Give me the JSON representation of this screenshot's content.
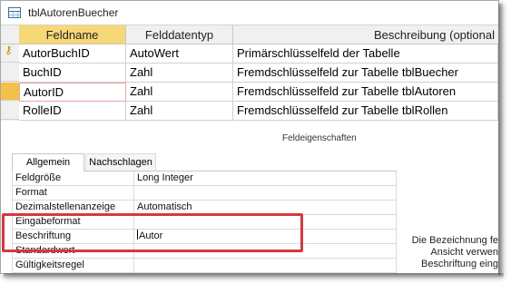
{
  "window": {
    "title": "tblAutorenBuecher",
    "icon": "table-icon"
  },
  "grid": {
    "columns": [
      "Feldname",
      "Felddatentyp",
      "Beschreibung (optional"
    ],
    "rows": [
      {
        "name": "AutorBuchID",
        "type": "AutoWert",
        "description": "Primärschlüsselfeld der Tabelle",
        "key": true
      },
      {
        "name": "BuchID",
        "type": "Zahl",
        "description": "Fremdschlüsselfeld zur Tabelle tblBuecher",
        "key": false
      },
      {
        "name": "AutorID",
        "type": "Zahl",
        "description": "Fremdschlüsselfeld zur Tabelle tblAutoren",
        "key": false,
        "current": true
      },
      {
        "name": "RolleID",
        "type": "Zahl",
        "description": "Fremdschlüsselfeld zur Tabelle tblRollen",
        "key": false
      }
    ]
  },
  "field_properties_label": "Feldeigenschaften",
  "tabs": {
    "general": "Allgemein",
    "lookup": "Nachschlagen"
  },
  "properties": [
    {
      "name": "Feldgröße",
      "value": "Long Integer"
    },
    {
      "name": "Format",
      "value": ""
    },
    {
      "name": "Dezimalstellenanzeige",
      "value": "Automatisch"
    },
    {
      "name": "Eingabeformat",
      "value": ""
    },
    {
      "name": "Beschriftung",
      "value": "Autor"
    },
    {
      "name": "Standardwert",
      "value": ""
    },
    {
      "name": "Gültigkeitsregel",
      "value": ""
    }
  ],
  "help_text": [
    "Die Bezeichnung fe",
    "Ansicht verwen",
    "Beschriftung eing"
  ],
  "colors": {
    "accent_header": "#f7d877",
    "current_row_selector": "#f5c04a",
    "highlight_box": "#d6383f"
  }
}
